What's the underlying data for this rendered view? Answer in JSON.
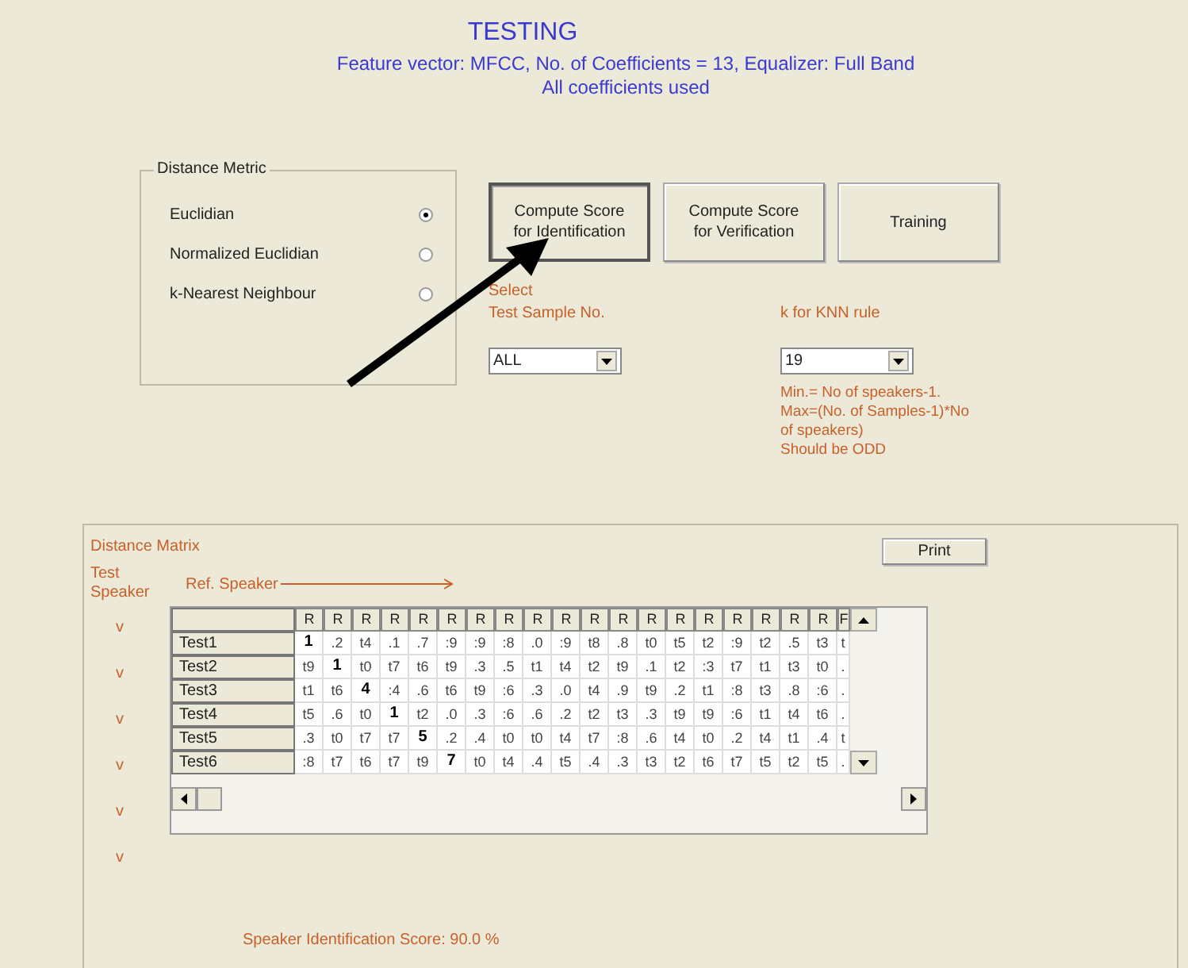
{
  "header": {
    "title": "TESTING",
    "lines": [
      "Feature vector: MFCC, No. of Coefficients = 13, Equalizer: Full Band",
      "All coefficients used"
    ]
  },
  "distance_metric": {
    "title": "Distance Metric",
    "options": [
      {
        "label": "Euclidian",
        "selected": true
      },
      {
        "label": "Normalized Euclidian",
        "selected": false
      },
      {
        "label": "k-Nearest Neighbour",
        "selected": false
      }
    ]
  },
  "buttons": [
    {
      "lines": [
        "Compute Score",
        "for Identification"
      ],
      "pressed": true
    },
    {
      "lines": [
        "Compute Score",
        "for Verification"
      ],
      "pressed": false
    },
    {
      "lines": [
        "Training"
      ],
      "pressed": false
    }
  ],
  "test_sample": {
    "caption": "Select",
    "label": "Test Sample No.",
    "value": "ALL"
  },
  "knn": {
    "label": "k for KNN rule",
    "value": "19",
    "notes": [
      "Min.= No of speakers-1.",
      "Max=(No. of Samples-1)*No",
      "of speakers)",
      "Should be ODD"
    ]
  },
  "distance_matrix": {
    "title": "Distance Matrix",
    "row_axis": [
      "Test",
      "Speaker"
    ],
    "column_axis": "Ref. Speaker",
    "print_button": "Print",
    "markers": [
      "v",
      "v",
      "v",
      "v",
      "v",
      "v"
    ],
    "columns": [
      "R",
      "R",
      "R",
      "R",
      "R",
      "R",
      "R",
      "R",
      "R",
      "R",
      "R",
      "R",
      "R",
      "R",
      "R",
      "R",
      "R",
      "R",
      "R",
      "F"
    ],
    "rows": [
      {
        "label": "Test1",
        "cells": [
          {
            "text": "1",
            "bold": true
          },
          {
            "text": ".2",
            "bold": false
          },
          {
            "text": "t4",
            "bold": false
          },
          {
            "text": ".1",
            "bold": false
          },
          {
            "text": ".7",
            "bold": false
          },
          {
            "text": ":9",
            "bold": false
          },
          {
            "text": ":9",
            "bold": false
          },
          {
            "text": ":8",
            "bold": false
          },
          {
            "text": ".0",
            "bold": false
          },
          {
            "text": ":9",
            "bold": false
          },
          {
            "text": "t8",
            "bold": false
          },
          {
            "text": ".8",
            "bold": false
          },
          {
            "text": "t0",
            "bold": false
          },
          {
            "text": "t5",
            "bold": false
          },
          {
            "text": "t2",
            "bold": false
          },
          {
            "text": ":9",
            "bold": false
          },
          {
            "text": "t2",
            "bold": false
          },
          {
            "text": ".5",
            "bold": false
          },
          {
            "text": "t3",
            "bold": false
          },
          {
            "text": "t",
            "bold": false
          }
        ]
      },
      {
        "label": "Test2",
        "cells": [
          {
            "text": "t9",
            "bold": false
          },
          {
            "text": "1",
            "bold": true
          },
          {
            "text": "t0",
            "bold": false
          },
          {
            "text": "t7",
            "bold": false
          },
          {
            "text": "t6",
            "bold": false
          },
          {
            "text": "t9",
            "bold": false
          },
          {
            "text": ".3",
            "bold": false
          },
          {
            "text": ".5",
            "bold": false
          },
          {
            "text": "t1",
            "bold": false
          },
          {
            "text": "t4",
            "bold": false
          },
          {
            "text": "t2",
            "bold": false
          },
          {
            "text": "t9",
            "bold": false
          },
          {
            "text": ".1",
            "bold": false
          },
          {
            "text": "t2",
            "bold": false
          },
          {
            "text": ":3",
            "bold": false
          },
          {
            "text": "t7",
            "bold": false
          },
          {
            "text": "t1",
            "bold": false
          },
          {
            "text": "t3",
            "bold": false
          },
          {
            "text": "t0",
            "bold": false
          },
          {
            "text": ".",
            "bold": false
          }
        ]
      },
      {
        "label": "Test3",
        "cells": [
          {
            "text": "t1",
            "bold": false
          },
          {
            "text": "t6",
            "bold": false
          },
          {
            "text": "4",
            "bold": true
          },
          {
            "text": ":4",
            "bold": false
          },
          {
            "text": ".6",
            "bold": false
          },
          {
            "text": "t6",
            "bold": false
          },
          {
            "text": "t9",
            "bold": false
          },
          {
            "text": ":6",
            "bold": false
          },
          {
            "text": ".3",
            "bold": false
          },
          {
            "text": ".0",
            "bold": false
          },
          {
            "text": "t4",
            "bold": false
          },
          {
            "text": ".9",
            "bold": false
          },
          {
            "text": "t9",
            "bold": false
          },
          {
            "text": ".2",
            "bold": false
          },
          {
            "text": "t1",
            "bold": false
          },
          {
            "text": ":8",
            "bold": false
          },
          {
            "text": "t3",
            "bold": false
          },
          {
            "text": ".8",
            "bold": false
          },
          {
            "text": ":6",
            "bold": false
          },
          {
            "text": ".",
            "bold": false
          }
        ]
      },
      {
        "label": "Test4",
        "cells": [
          {
            "text": "t5",
            "bold": false
          },
          {
            "text": ".6",
            "bold": false
          },
          {
            "text": "t0",
            "bold": false
          },
          {
            "text": "1",
            "bold": true
          },
          {
            "text": "t2",
            "bold": false
          },
          {
            "text": ".0",
            "bold": false
          },
          {
            "text": ".3",
            "bold": false
          },
          {
            "text": ":6",
            "bold": false
          },
          {
            "text": ".6",
            "bold": false
          },
          {
            "text": ".2",
            "bold": false
          },
          {
            "text": "t2",
            "bold": false
          },
          {
            "text": "t3",
            "bold": false
          },
          {
            "text": ".3",
            "bold": false
          },
          {
            "text": "t9",
            "bold": false
          },
          {
            "text": "t9",
            "bold": false
          },
          {
            "text": ":6",
            "bold": false
          },
          {
            "text": "t1",
            "bold": false
          },
          {
            "text": "t4",
            "bold": false
          },
          {
            "text": "t6",
            "bold": false
          },
          {
            "text": ".",
            "bold": false
          }
        ]
      },
      {
        "label": "Test5",
        "cells": [
          {
            "text": ".3",
            "bold": false
          },
          {
            "text": "t0",
            "bold": false
          },
          {
            "text": "t7",
            "bold": false
          },
          {
            "text": "t7",
            "bold": false
          },
          {
            "text": "5",
            "bold": true
          },
          {
            "text": ".2",
            "bold": false
          },
          {
            "text": ".4",
            "bold": false
          },
          {
            "text": "t0",
            "bold": false
          },
          {
            "text": "t0",
            "bold": false
          },
          {
            "text": "t4",
            "bold": false
          },
          {
            "text": "t7",
            "bold": false
          },
          {
            "text": ":8",
            "bold": false
          },
          {
            "text": ".6",
            "bold": false
          },
          {
            "text": "t4",
            "bold": false
          },
          {
            "text": "t0",
            "bold": false
          },
          {
            "text": ".2",
            "bold": false
          },
          {
            "text": "t4",
            "bold": false
          },
          {
            "text": "t1",
            "bold": false
          },
          {
            "text": ".4",
            "bold": false
          },
          {
            "text": "t",
            "bold": false
          }
        ]
      },
      {
        "label": "Test6",
        "cells": [
          {
            "text": ":8",
            "bold": false
          },
          {
            "text": "t7",
            "bold": false
          },
          {
            "text": "t6",
            "bold": false
          },
          {
            "text": "t7",
            "bold": false
          },
          {
            "text": "t9",
            "bold": false
          },
          {
            "text": "7",
            "bold": true
          },
          {
            "text": "t0",
            "bold": false
          },
          {
            "text": "t4",
            "bold": false
          },
          {
            "text": ".4",
            "bold": false
          },
          {
            "text": "t5",
            "bold": false
          },
          {
            "text": ".4",
            "bold": false
          },
          {
            "text": ".3",
            "bold": false
          },
          {
            "text": "t3",
            "bold": false
          },
          {
            "text": "t2",
            "bold": false
          },
          {
            "text": "t6",
            "bold": false
          },
          {
            "text": "t7",
            "bold": false
          },
          {
            "text": "t5",
            "bold": false
          },
          {
            "text": "t2",
            "bold": false
          },
          {
            "text": "t5",
            "bold": false
          },
          {
            "text": ".",
            "bold": false
          }
        ]
      }
    ],
    "score": "Speaker Identification Score: 90.0 %"
  }
}
